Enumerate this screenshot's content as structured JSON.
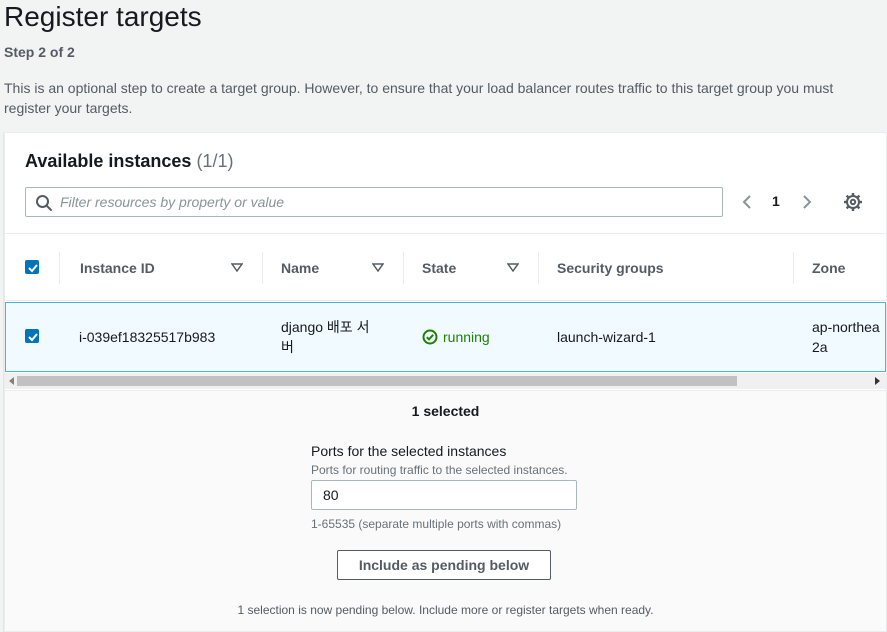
{
  "page": {
    "title": "Register targets",
    "step": "Step 2 of 2",
    "description": "This is an optional step to create a target group. However, to ensure that your load balancer routes traffic to this target group you must register your targets."
  },
  "instances": {
    "title": "Available instances",
    "count": "(1/1)",
    "filter_placeholder": "Filter resources by property or value",
    "page_number": "1",
    "columns": [
      "Instance ID",
      "Name",
      "State",
      "Security groups",
      "Zone"
    ],
    "rows": [
      {
        "instance_id": "i-039ef18325517b983",
        "name_line1": "django 배포 서",
        "name_line2": "버",
        "state": "running",
        "security_groups": "launch-wizard-1",
        "zone_line1": "ap-northea",
        "zone_line2": "2a",
        "selected": true
      }
    ]
  },
  "selection": {
    "summary": "1 selected",
    "ports_label": "Ports for the selected instances",
    "ports_description": "Ports for routing traffic to the selected instances.",
    "ports_value": "80",
    "ports_hint": "1-65535 (separate multiple ports with commas)",
    "include_button": "Include as pending below",
    "pending_note": "1 selection is now pending below. Include more or register targets when ready."
  },
  "colors": {
    "accent": "#0073bb",
    "running": "#1d8102",
    "selected_row_bg": "#f1faff",
    "selected_row_border": "#44b9d6"
  },
  "icons": [
    "search-icon",
    "chevron-left-icon",
    "chevron-right-icon",
    "gear-icon",
    "sort-caret-icon",
    "check-circle-icon",
    "checkbox-checked-icon"
  ]
}
